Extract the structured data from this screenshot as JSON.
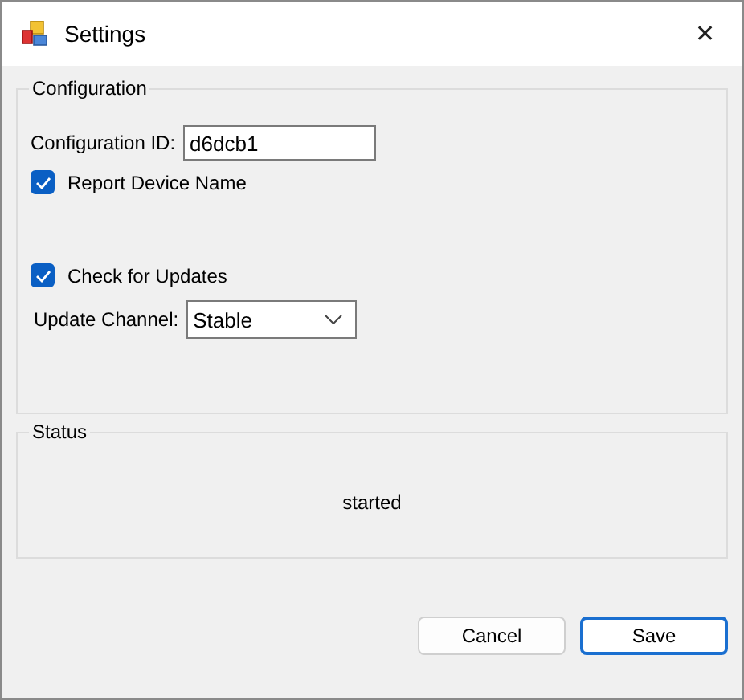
{
  "window": {
    "title": "Settings",
    "close": "✕"
  },
  "configuration": {
    "title": "Configuration",
    "id_label": "Configuration ID:",
    "id_value": "d6dcb1",
    "report_device_name": {
      "label": "Report Device Name",
      "checked": true
    },
    "check_for_updates": {
      "label": "Check for Updates",
      "checked": true
    },
    "channel_label": "Update Channel:",
    "channel_value": "Stable"
  },
  "status": {
    "title": "Status",
    "text": "started"
  },
  "buttons": [
    {
      "label": "Cancel",
      "default": false
    },
    {
      "label": "Save",
      "default": true
    }
  ]
}
